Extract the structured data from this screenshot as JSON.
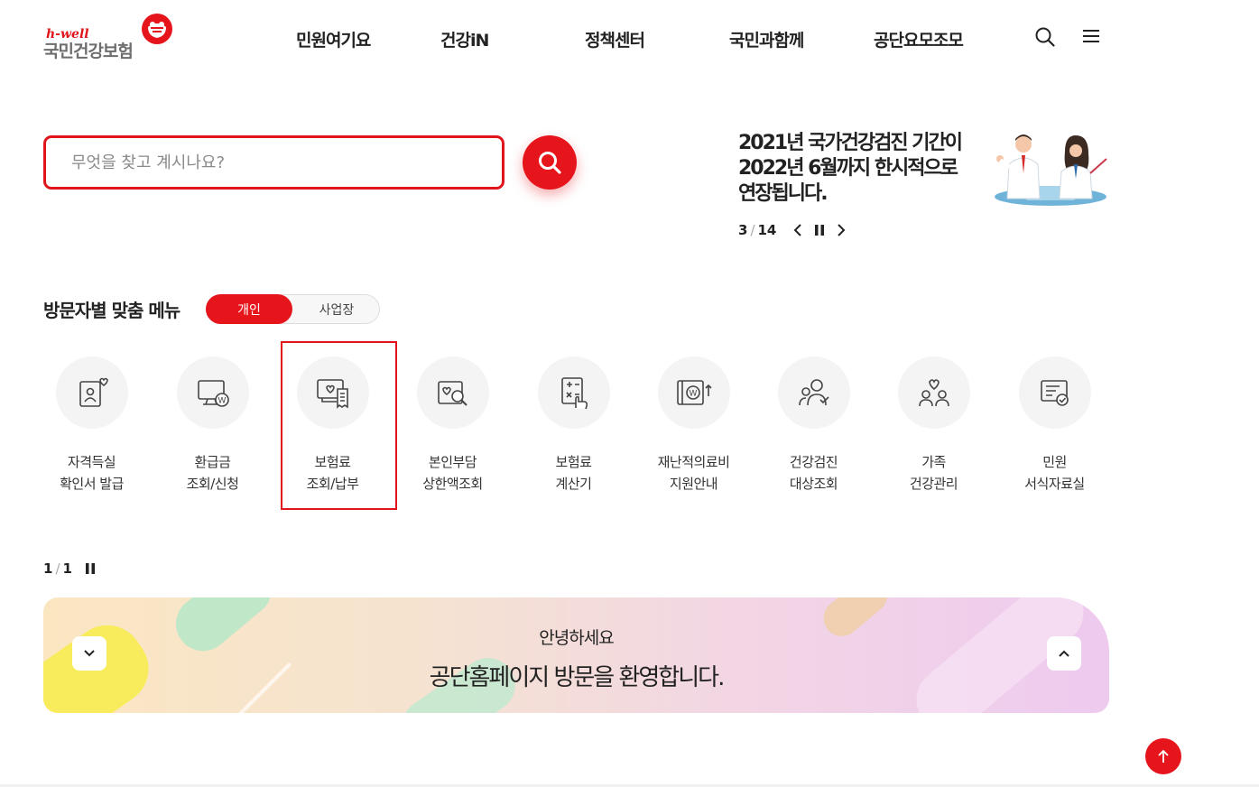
{
  "logo": {
    "sub": "h-well",
    "main": "국민건강보험"
  },
  "gnb": [
    {
      "label": "민원여기요"
    },
    {
      "label": "건강iN"
    },
    {
      "label": "정책센터"
    },
    {
      "label": "국민과함께"
    },
    {
      "label": "공단요모조모"
    }
  ],
  "utility": {
    "search_icon": "search-icon",
    "menu_icon": "hamburger-icon"
  },
  "search": {
    "placeholder": "무엇을 찾고 계시나요?",
    "value": ""
  },
  "notice": {
    "text": "2021년 국가건강검진 기간이\n2022년 6월까지 한시적으로\n연장됩니다.",
    "current": "3",
    "total": "14"
  },
  "visitor_menu": {
    "title": "방문자별 맞춤 메뉴",
    "toggle": {
      "active": "개인",
      "inactive": "사업장"
    },
    "items": [
      {
        "label": "자격득실\n확인서 발급",
        "icon": "id-card-heart-icon"
      },
      {
        "label": "환급금\n조회/신청",
        "icon": "monitor-won-icon"
      },
      {
        "label": "보험료\n조회/납부",
        "icon": "insurance-bill-icon"
      },
      {
        "label": "본인부담\n상한액조회",
        "icon": "heart-search-icon"
      },
      {
        "label": "보험료\n계산기",
        "icon": "calculator-hand-icon"
      },
      {
        "label": "재난적의료비\n지원안내",
        "icon": "won-support-icon"
      },
      {
        "label": "건강검진\n대상조회",
        "icon": "people-search-icon"
      },
      {
        "label": "가족\n건강관리",
        "icon": "family-heart-icon"
      },
      {
        "label": "민원\n서식자료실",
        "icon": "document-check-icon"
      }
    ],
    "pager": {
      "current": "1",
      "total": "1"
    }
  },
  "banner": {
    "greeting": "안녕하세요",
    "welcome": "공단홈페이지 방문을 환영합니다."
  },
  "colors": {
    "brand_red": "#e6141b",
    "logo_gray": "#6d6d6d"
  }
}
